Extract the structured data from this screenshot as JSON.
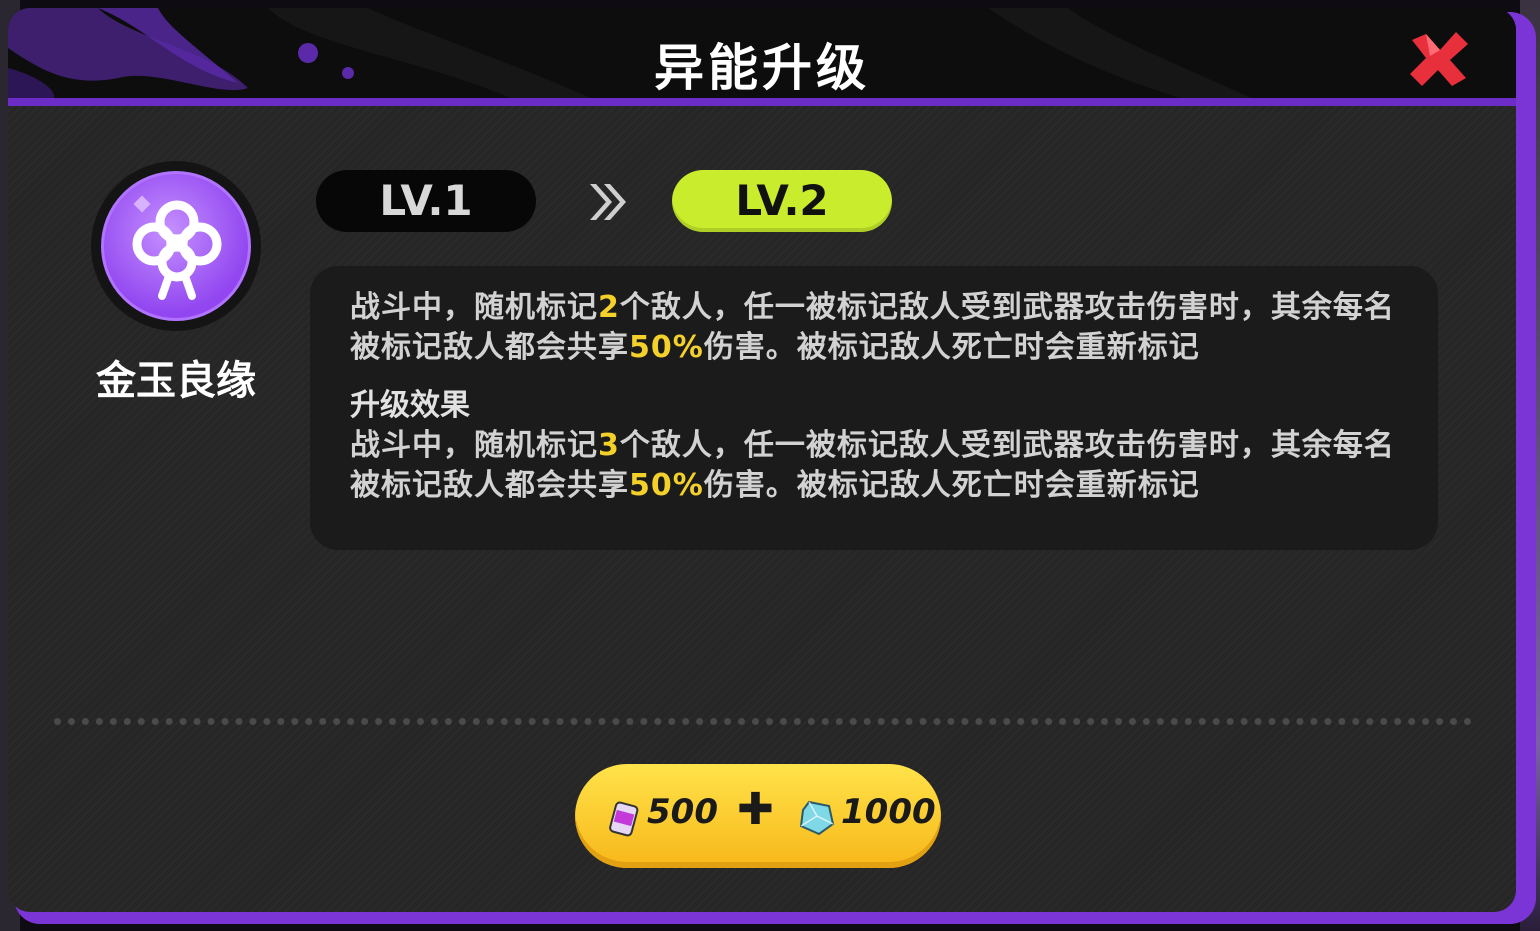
{
  "dialog": {
    "title": "异能升级",
    "close_icon": "close-x-icon",
    "accent_color": "#6c2dc7"
  },
  "skill": {
    "name": "金玉良缘",
    "icon": "knot-charm-icon"
  },
  "levels": {
    "current": "LV.1",
    "next": "LV.2",
    "arrow_icon": "double-chevron-right-icon"
  },
  "description": {
    "current": {
      "part1": "战斗中，随机标记",
      "count": "2",
      "part2": "个敌人，任一被标记敌人受到武器攻击伤害时，其余每名被标记敌人都会共享",
      "percent": "50%",
      "part3": "伤害。被标记敌人死亡时会重新标记"
    },
    "upgrade_title": "升级效果",
    "upgrade": {
      "part1": "战斗中，随机标记",
      "count": "3",
      "part2": "个敌人，任一被标记敌人受到武器攻击伤害时，其余每名被标记敌人都会共享",
      "percent": "50%",
      "part3": "伤害。被标记敌人死亡时会重新标记"
    }
  },
  "cost": {
    "item1_icon": "purple-can-icon",
    "item1_amount": "500",
    "plus": "✚",
    "item2_icon": "crystal-icon",
    "item2_amount": "1000"
  }
}
